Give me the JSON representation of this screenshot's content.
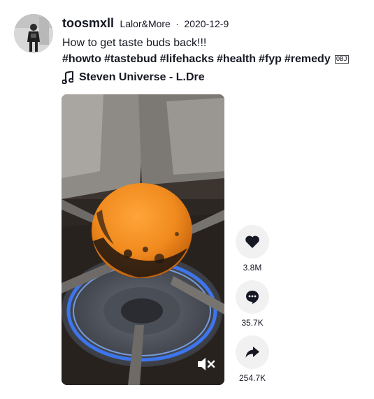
{
  "post": {
    "username": "toosmxll",
    "nickname": "Lalor&More",
    "separator": "·",
    "date": "2020-12-9",
    "caption_text": "How to get taste buds back!!!",
    "hashtags": [
      "#howto",
      "#tastebud",
      "#lifehacks",
      "#health",
      "#fyp",
      "#remedy"
    ],
    "caption_emoji": "OBJ",
    "music": {
      "icon": "music-note-icon",
      "title": "Steven Universe - L.Dre"
    }
  },
  "video": {
    "mute_icon": "speaker-muted-icon"
  },
  "actions": {
    "likes": {
      "icon": "heart-icon",
      "count": "3.8M"
    },
    "comments": {
      "icon": "comment-bubble-icon",
      "count": "35.7K"
    },
    "shares": {
      "icon": "share-arrow-icon",
      "count": "254.7K"
    }
  },
  "colors": {
    "text": "#161823",
    "action_bg": "#f1f1f2",
    "orange": "#f08a1e"
  }
}
